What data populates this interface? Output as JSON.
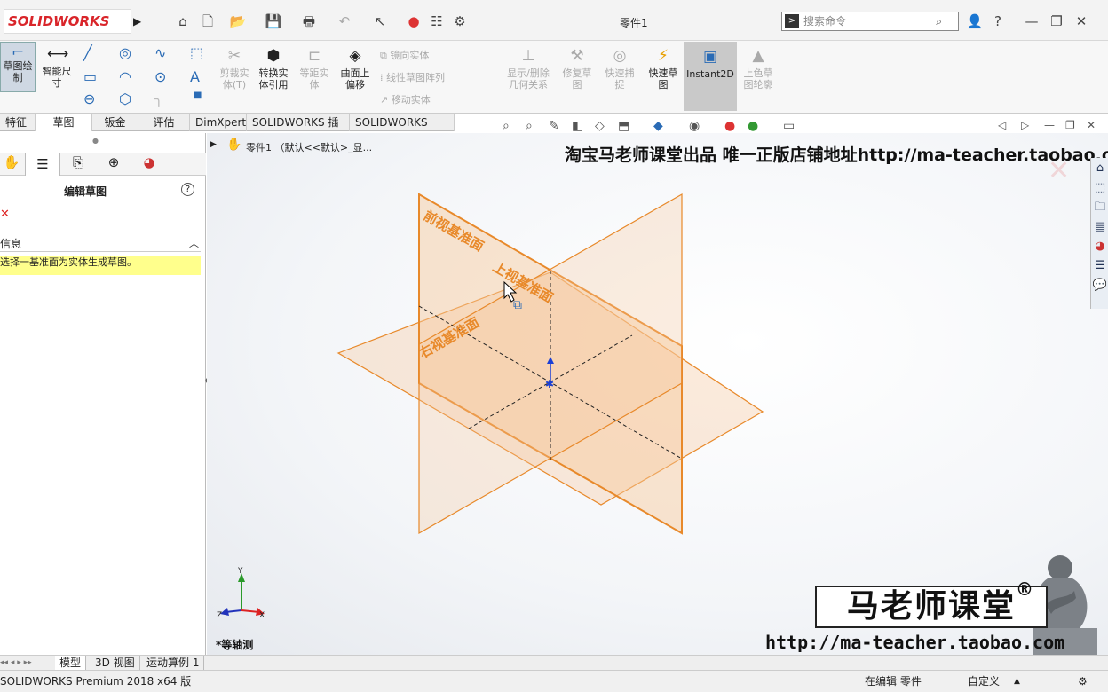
{
  "app": {
    "logo": "SOLIDWORKS",
    "window_title": "零件1"
  },
  "search": {
    "placeholder": "搜索命令",
    "prefix": ">"
  },
  "titlebar": {
    "user": "👤",
    "help": "?",
    "minimize": "—",
    "restore": "❐",
    "close": "✕"
  },
  "ribbon": {
    "sketch": "草图绘\n制",
    "smart_dim": "智能尺\n寸",
    "trim": "剪裁实\n体(T)",
    "convert": "转换实\n体引用",
    "offset": "等距实\n体",
    "surface_offset": "曲面上\n偏移",
    "mirror": "镜向实体",
    "linear_pattern": "线性草图阵列",
    "move": "移动实体",
    "show_hide": "显示/删除\n几何关系",
    "repair": "修复草\n图",
    "quick_snap": "快速捕\n捉",
    "rapid_sketch": "快速草\n图",
    "instant2d": "Instant2D",
    "shaded": "上色草\n图轮廓"
  },
  "tabs": [
    "特征",
    "草图",
    "钣金",
    "评估",
    "DimXpert",
    "SOLIDWORKS 插件",
    "SOLIDWORKS MBD"
  ],
  "tree": {
    "root": "零件1 （默认<<默认>_显..."
  },
  "panel": {
    "title": "编辑草图",
    "help": "?",
    "close": "✕",
    "section": "信息",
    "message": "选择一基准面为实体生成草图。"
  },
  "planes": {
    "front": "前视基准面",
    "top": "上视基准面",
    "right": "右视基准面"
  },
  "triad": {
    "x": "X",
    "y": "Y",
    "z": "Z"
  },
  "view_label": "*等轴测",
  "watermark": "淘宝马老师课堂出品 唯一正版店铺地址http://ma-teacher.taobao.com",
  "brand": {
    "name": "马老师课堂",
    "reg": "®",
    "url": "http://ma-teacher.taobao.com"
  },
  "bottom_tabs": [
    "模型",
    "3D 视图",
    "运动算例 1"
  ],
  "status": {
    "version": "SOLIDWORKS Premium 2018 x64 版",
    "mode": "在编辑 零件",
    "custom": "自定义"
  },
  "colors": {
    "plane_edge": "#e8892a",
    "plane_fill": "#f6c79a",
    "plane_text": "#e8892a"
  }
}
